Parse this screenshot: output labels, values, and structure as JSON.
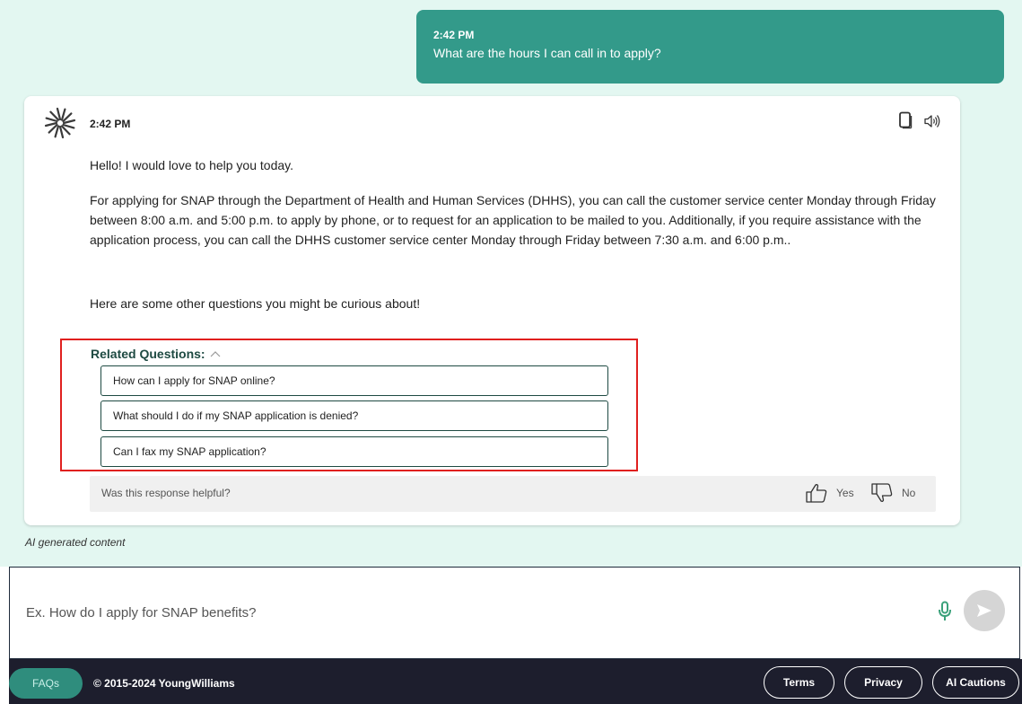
{
  "user_message": {
    "time": "2:42 PM",
    "text": "What are the hours I can call in to apply?"
  },
  "bot_message": {
    "time": "2:42 PM",
    "paragraphs": [
      "Hello! I would love to help you today.",
      "For applying for SNAP through the Department of Health and Human Services (DHHS), you can call the customer service center Monday through Friday between 8:00 a.m. and 5:00 p.m. to apply by phone, or to request for an application to be mailed to you. Additionally, if you require assistance with the application process, you can call the DHHS customer service center Monday through Friday between 7:30 a.m. and 6:00 p.m..",
      "Here are some other questions you might be curious about!"
    ],
    "icons": {
      "copy": "copy-icon",
      "speaker": "speaker-icon"
    }
  },
  "related": {
    "header": "Related Questions:",
    "questions": [
      "How can I apply for SNAP online?",
      "What should I do if my SNAP application is denied?",
      "Can I fax my SNAP application?"
    ]
  },
  "feedback": {
    "question": "Was this response helpful?",
    "yes_label": "Yes",
    "no_label": "No"
  },
  "ai_note": "AI generated content",
  "input": {
    "placeholder": "Ex. How do I apply for SNAP benefits?",
    "value": ""
  },
  "footer": {
    "faq_label": "FAQs",
    "copyright": "© 2015-2024 YoungWilliams",
    "terms_label": "Terms",
    "privacy_label": "Privacy",
    "ai_cautions_label": "AI Cautions"
  },
  "colors": {
    "chat_background": "#e3f7f1",
    "user_bubble": "#339a8a",
    "accent_dark": "#1e4a42",
    "highlight_border": "#e0201f",
    "footer_background": "#1d1e2d",
    "faq_button": "#2f8d7d",
    "mic": "#3aa17a"
  }
}
